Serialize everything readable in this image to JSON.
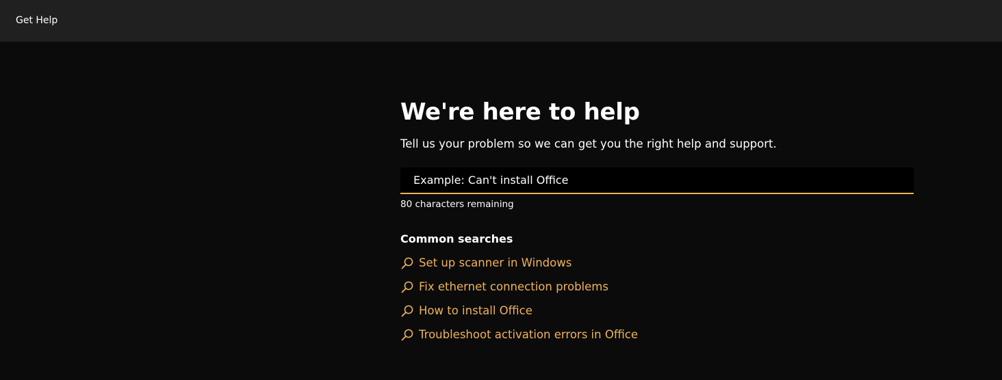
{
  "app": {
    "title": "Get Help"
  },
  "main": {
    "headline": "We're here to help",
    "subtitle": "Tell us your problem so we can get you the right help and support.",
    "search": {
      "placeholder": "Example: Can't install Office",
      "value": "",
      "remaining": "80 characters remaining"
    },
    "common": {
      "header": "Common searches",
      "items": [
        {
          "label": "Set up scanner in Windows",
          "icon": "search-icon"
        },
        {
          "label": "Fix ethernet connection problems",
          "icon": "search-icon"
        },
        {
          "label": "How to install Office",
          "icon": "search-icon"
        },
        {
          "label": "Troubleshoot activation errors in Office",
          "icon": "search-icon"
        }
      ]
    }
  },
  "colors": {
    "accent": "#f0b35a",
    "background": "#0b0b0b",
    "titlebar": "#202020"
  }
}
